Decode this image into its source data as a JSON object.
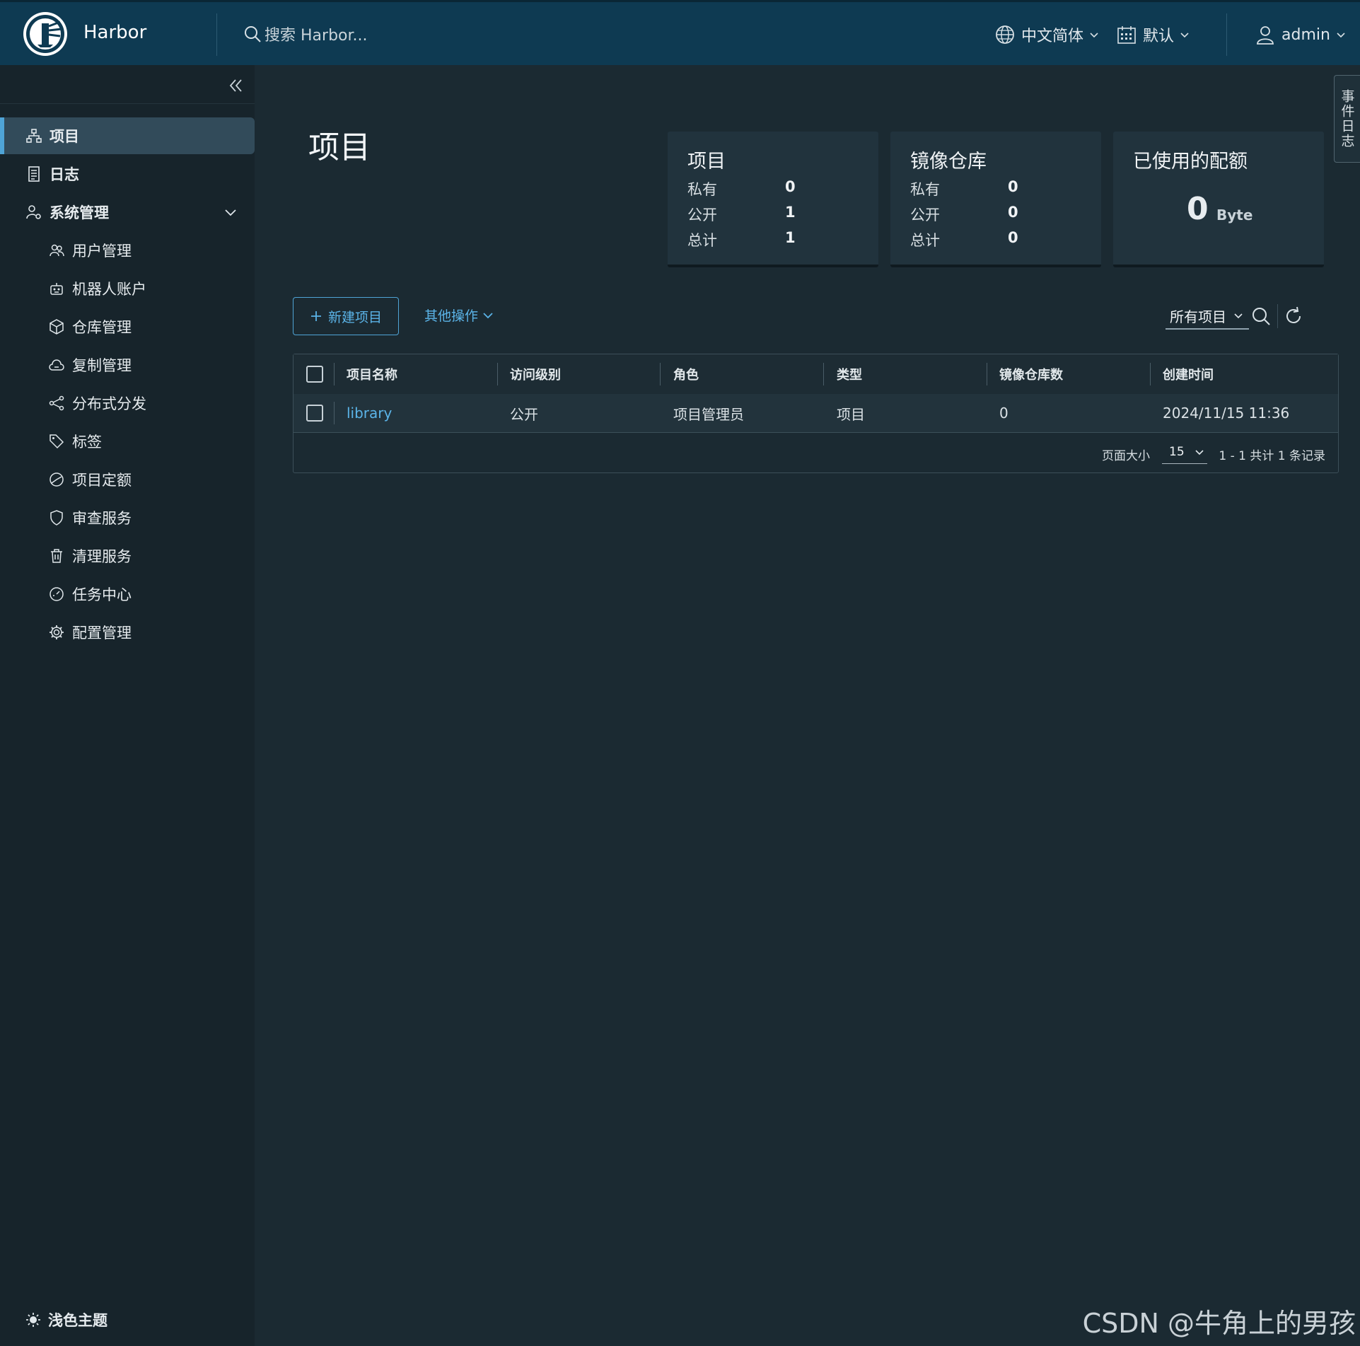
{
  "header": {
    "brand": "Harbor",
    "search_placeholder": "搜索 Harbor...",
    "language": "中文简体",
    "datetime_format": "默认",
    "user": "admin"
  },
  "sidebar": {
    "items": [
      {
        "label": "项目",
        "icon": "projects-icon",
        "active": true
      },
      {
        "label": "日志",
        "icon": "log-icon"
      },
      {
        "label": "系统管理",
        "icon": "admin-icon",
        "expanded": true
      }
    ],
    "sub_items": [
      {
        "label": "用户管理",
        "icon": "users-icon"
      },
      {
        "label": "机器人账户",
        "icon": "robot-icon"
      },
      {
        "label": "仓库管理",
        "icon": "registry-icon"
      },
      {
        "label": "复制管理",
        "icon": "cloud-icon"
      },
      {
        "label": "分布式分发",
        "icon": "share-icon"
      },
      {
        "label": "标签",
        "icon": "tag-icon"
      },
      {
        "label": "项目定额",
        "icon": "quota-icon"
      },
      {
        "label": "审查服务",
        "icon": "shield-icon"
      },
      {
        "label": "清理服务",
        "icon": "trash-icon"
      },
      {
        "label": "任务中心",
        "icon": "gauge-icon"
      },
      {
        "label": "配置管理",
        "icon": "gear-icon"
      }
    ],
    "theme_toggle": "浅色主题"
  },
  "main": {
    "title": "项目",
    "cards": {
      "projects": {
        "title": "项目",
        "private_label": "私有",
        "private": "0",
        "public_label": "公开",
        "public": "1",
        "total_label": "总计",
        "total": "1"
      },
      "repositories": {
        "title": "镜像仓库",
        "private_label": "私有",
        "private": "0",
        "public_label": "公开",
        "public": "0",
        "total_label": "总计",
        "total": "0"
      },
      "quota": {
        "title": "已使用的配额",
        "value": "0",
        "unit": "Byte"
      }
    },
    "toolbar": {
      "new_project": "新建项目",
      "other_actions": "其他操作",
      "filter": "所有项目"
    },
    "table": {
      "columns": [
        "项目名称",
        "访问级别",
        "角色",
        "类型",
        "镜像仓库数",
        "创建时间"
      ],
      "rows": [
        [
          "library",
          "公开",
          "项目管理员",
          "项目",
          "0",
          "2024/11/15 11:36"
        ]
      ],
      "page_size_label": "页面大小",
      "page_size": "15",
      "page_info": "1 - 1 共计 1 条记录"
    }
  },
  "event_log_tab": "事件日志",
  "watermark": "CSDN @牛角上的男孩",
  "colors": {
    "header_bg": "#0e3a52",
    "accent": "#4fa4d6",
    "sidebar_bg": "#17242b",
    "main_bg": "#1b2a32"
  }
}
